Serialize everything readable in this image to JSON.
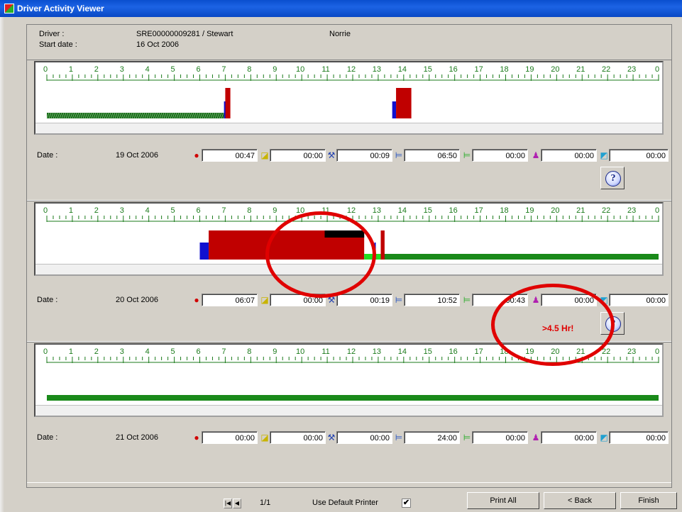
{
  "window": {
    "title": "Driver Activity Viewer"
  },
  "header": {
    "driver_label": "Driver :",
    "driver_value": "SRE00000009281 / Stewart",
    "driver_extra": "Norrie",
    "start_label": "Start date :",
    "start_value": "16 Oct 2006"
  },
  "hours": [
    "0",
    "1",
    "2",
    "3",
    "4",
    "5",
    "6",
    "7",
    "8",
    "9",
    "10",
    "11",
    "12",
    "13",
    "14",
    "15",
    "16",
    "17",
    "18",
    "19",
    "20",
    "21",
    "22",
    "23",
    "0"
  ],
  "icons": [
    "steering-wheel-icon",
    "other-work-icon",
    "tools-icon",
    "bed-icon",
    "bed-green-icon",
    "person-icon",
    "available-icon"
  ],
  "days": [
    {
      "date_label": "Date :",
      "date": "19 Oct 2006",
      "values": [
        "00:47",
        "00:00",
        "00:09",
        "06:50",
        "00:00",
        "00:00",
        "00:00"
      ],
      "warning": "",
      "segments": [
        {
          "type": "rest_hatched",
          "start": 0,
          "end": 7.05,
          "color": "#1a6b1a"
        },
        {
          "type": "drive",
          "start": 7.0,
          "end": 7.2,
          "color": "#c00000"
        },
        {
          "type": "work",
          "start": 6.95,
          "end": 7.0,
          "color": "#1010d0"
        },
        {
          "type": "work",
          "start": 13.55,
          "end": 13.7,
          "color": "#1010d0"
        },
        {
          "type": "drive",
          "start": 13.7,
          "end": 14.3,
          "color": "#c00000"
        }
      ]
    },
    {
      "date_label": "Date :",
      "date": "20 Oct 2006",
      "values": [
        "06:07",
        "00:00",
        "00:19",
        "10:52",
        "00:43",
        "00:00",
        "00:00"
      ],
      "warning": ">4.5 Hr!",
      "segments": [
        {
          "type": "work",
          "start": 6.0,
          "end": 6.35,
          "color": "#1010d0"
        },
        {
          "type": "drive",
          "start": 6.35,
          "end": 12.45,
          "color": "#c00000"
        },
        {
          "type": "black",
          "start": 10.9,
          "end": 12.45,
          "color": "#000000"
        },
        {
          "type": "rest_light",
          "start": 12.45,
          "end": 13.2,
          "color": "#22dd22"
        },
        {
          "type": "rest",
          "start": 13.2,
          "end": 24,
          "color": "#1a8a1a"
        },
        {
          "type": "drive",
          "start": 13.1,
          "end": 13.25,
          "color": "#c00000"
        },
        {
          "type": "work",
          "start": 12.85,
          "end": 12.9,
          "color": "#1010d0"
        }
      ]
    },
    {
      "date_label": "Date :",
      "date": "21 Oct 2006",
      "values": [
        "00:00",
        "00:00",
        "00:00",
        "24:00",
        "00:00",
        "00:00",
        "00:00"
      ],
      "warning": "",
      "segments": [
        {
          "type": "rest",
          "start": 0,
          "end": 24,
          "color": "#1a8a1a"
        }
      ]
    }
  ],
  "footer": {
    "page": "1/1",
    "printer_label": "Use Default Printer",
    "printer_checked": "✔",
    "print_all": "Print All",
    "back": "< Back",
    "finish": "Finish",
    "first_nav": "|◀",
    "prev_nav": "◀"
  }
}
